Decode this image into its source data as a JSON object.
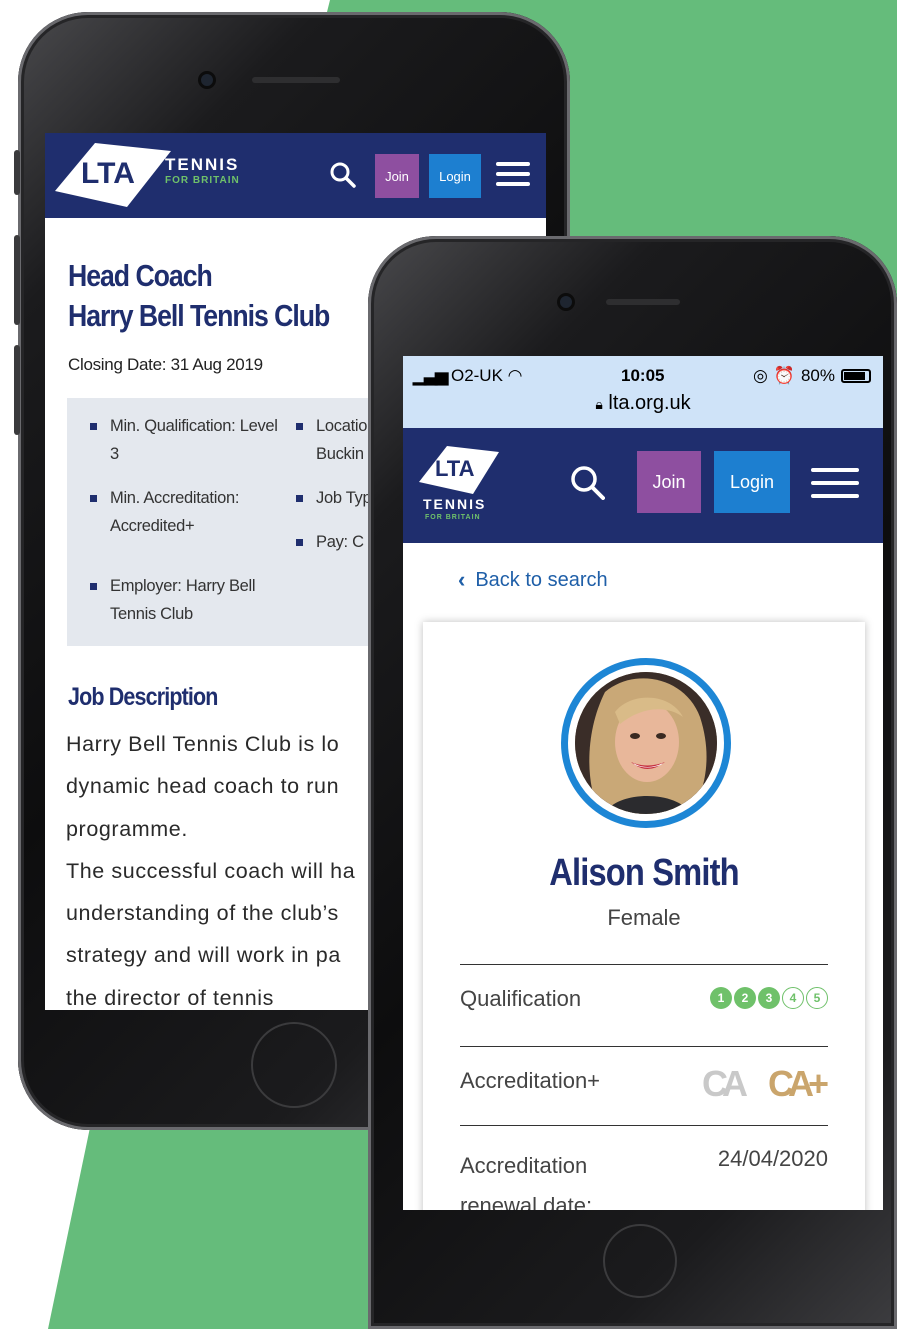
{
  "colors": {
    "background_green": "#65bc7b",
    "header_navy": "#1f2e6e",
    "join_purple": "#8e4fa0",
    "login_blue": "#1d7fd0",
    "qualification_green": "#6fc16a"
  },
  "brand": {
    "logo_text": "LTA",
    "tennis": "TENNIS",
    "for_britain": "FOR BRITAIN"
  },
  "header": {
    "join_label": "Join",
    "login_label": "Login",
    "search_icon": "search-icon",
    "menu_icon": "hamburger-menu-icon"
  },
  "job": {
    "title_line1": "Head Coach",
    "title_line2": "Harry Bell Tennis Club",
    "closing_date": "Closing Date: 31 Aug 2019",
    "details": {
      "min_qualification_line1": "Min. Qualification: Level",
      "min_qualification_line2": "3",
      "min_accreditation_line1": "Min. Accreditation:",
      "min_accreditation_line2": "Accredited+",
      "employer_line1": "Employer: Harry Bell",
      "employer_line2": "Tennis Club",
      "location_line1": "Locatio",
      "location_line2": "Buckin",
      "job_type": "Job Typ",
      "pay": "Pay: C"
    },
    "description_heading": "Job Description",
    "description_lines": [
      "Harry Bell Tennis Club is lo",
      "dynamic head coach to run",
      "programme.",
      "The successful coach will ha",
      "understanding of the club’s",
      "strategy and will work in pa",
      "the director of tennis"
    ]
  },
  "status_bar": {
    "carrier": "O2-UK",
    "time": "10:05",
    "battery": "80%",
    "url": "lta.org.uk"
  },
  "profile": {
    "back_link": "Back to search",
    "name": "Alison Smith",
    "gender": "Female",
    "qualification_label": "Qualification",
    "qualification_levels": [
      "1",
      "2",
      "3",
      "4",
      "5"
    ],
    "qualification_achieved": 3,
    "accreditation_label": "Accreditation+",
    "accreditation_badges": [
      "CA",
      "CA+"
    ],
    "renewal_label_line1": "Accreditation",
    "renewal_label_line2": "renewal date:",
    "renewal_date": "24/04/2020"
  }
}
